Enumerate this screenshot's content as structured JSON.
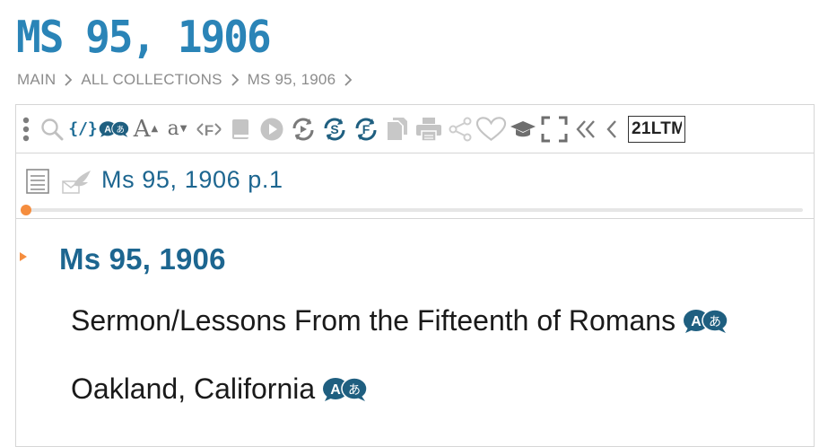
{
  "header": {
    "title": "MS 95, 1906"
  },
  "breadcrumb": [
    {
      "label": "MAIN"
    },
    {
      "label": "ALL COLLECTIONS"
    },
    {
      "label": "MS 95, 1906"
    }
  ],
  "toolbar": {
    "code_label": "{/}",
    "font_increase_label": "A",
    "font_decrease_label": "a",
    "reference_code_value": "21LTM",
    "icons": [
      "more-vertical-icon",
      "search-icon",
      "code-icon",
      "translate-icon",
      "font-increase-icon",
      "font-decrease-icon",
      "font-family-icon",
      "book-icon",
      "play-icon",
      "sync-icon",
      "sync-s-icon",
      "sync-f-icon",
      "copy-icon",
      "print-icon",
      "share-icon",
      "heart-icon",
      "graduation-cap-icon",
      "fullscreen-icon",
      "double-chevron-left-icon",
      "chevron-left-icon"
    ]
  },
  "reference": {
    "text": "Ms 95, 1906 p.1",
    "progress": 0.0
  },
  "content": {
    "heading": "Ms 95, 1906",
    "paragraphs": [
      {
        "text": "Sermon/Lessons From the Fifteenth of Romans"
      },
      {
        "text": "Oakland, California"
      }
    ]
  },
  "colors": {
    "title": "#2a84b7",
    "link": "#1d6690",
    "accent": "#f58d3e",
    "icon_gray": "#a8a8a8",
    "icon_dark": "#1f5f80"
  }
}
